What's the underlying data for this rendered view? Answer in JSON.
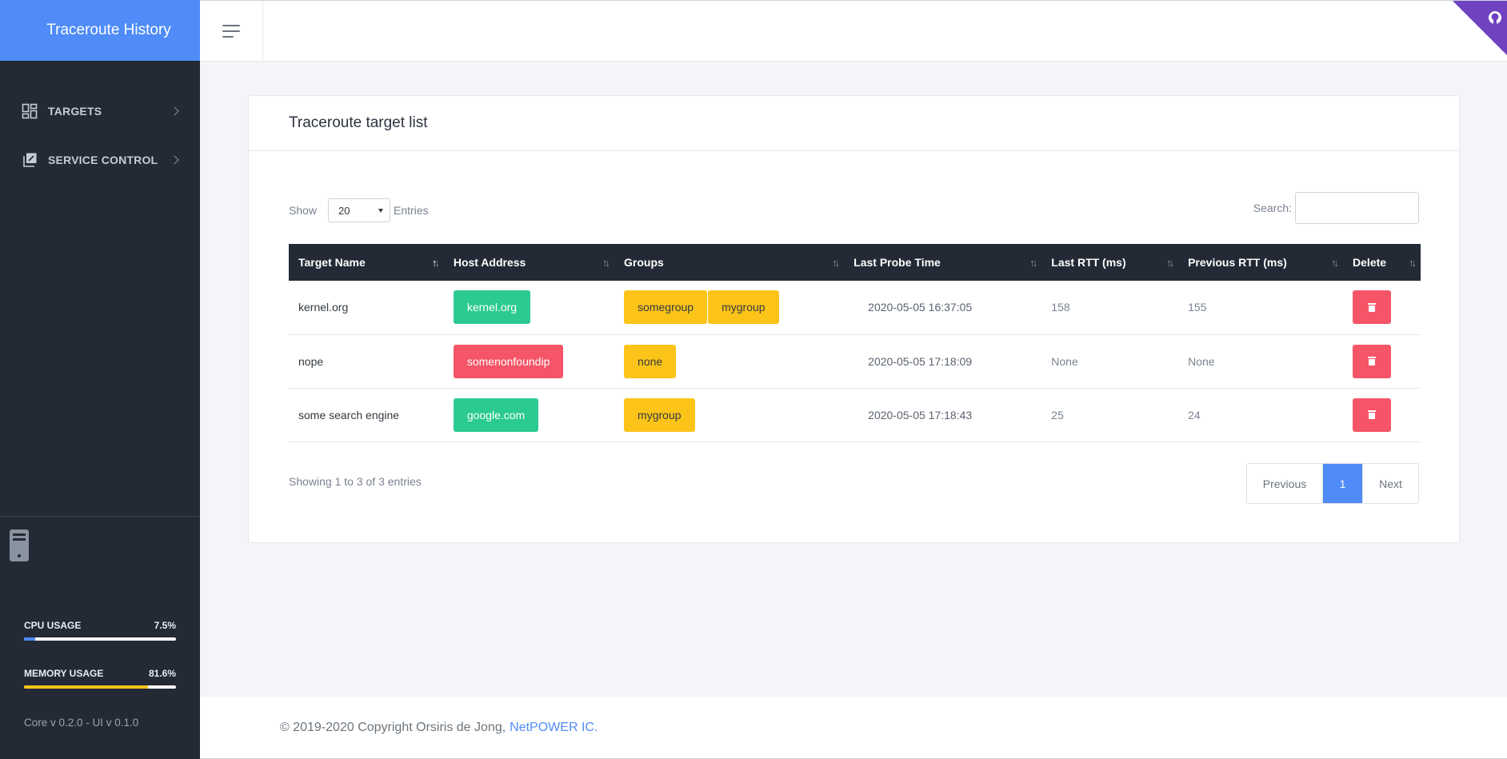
{
  "app": {
    "title": "Traceroute History"
  },
  "sidebar": {
    "items": [
      {
        "label": "TARGETS",
        "icon": "dashboard-grid-icon"
      },
      {
        "label": "SERVICE CONTROL",
        "icon": "edit-box-icon"
      }
    ],
    "cpu": {
      "label": "CPU USAGE",
      "value": "7.5%",
      "percent": 7.5,
      "color": "#4f8cf7"
    },
    "memory": {
      "label": "MEMORY USAGE",
      "value": "81.6%",
      "percent": 81.6,
      "color": "#fcc419"
    },
    "version": "Core v 0.2.0 - UI v 0.1.0"
  },
  "card": {
    "title": "Traceroute target list",
    "show_label": "Show",
    "entries_value": "20",
    "entries_label": "Entries",
    "search_label": "Search:",
    "search_value": "",
    "columns": [
      "Target Name",
      "Host Address",
      "Groups",
      "Last Probe Time",
      "Last RTT (ms)",
      "Previous RTT (ms)",
      "Delete"
    ],
    "rows": [
      {
        "name": "kernel.org",
        "host": "kernel.org",
        "host_status": "ok",
        "groups": [
          "somegroup",
          "mygroup"
        ],
        "last_probe": "2020-05-05 16:37:05",
        "last_rtt": "158",
        "prev_rtt": "155"
      },
      {
        "name": "nope",
        "host": "somenonfoundip",
        "host_status": "error",
        "groups": [
          "none"
        ],
        "last_probe": "2020-05-05 17:18:09",
        "last_rtt": "None",
        "prev_rtt": "None"
      },
      {
        "name": "some search engine",
        "host": "google.com",
        "host_status": "ok",
        "groups": [
          "mygroup"
        ],
        "last_probe": "2020-05-05 17:18:43",
        "last_rtt": "25",
        "prev_rtt": "24"
      }
    ],
    "info": "Showing 1 to 3 of 3 entries",
    "pagination": {
      "previous": "Previous",
      "current": "1",
      "next": "Next"
    }
  },
  "footer": {
    "copyright": "© 2019-2020 Copyright Orsiris de Jong,",
    "link": "NetPOWER IC."
  },
  "colors": {
    "brand": "#4f8cf7",
    "sidebar": "#232a35",
    "success": "#2bca90",
    "danger": "#f55567",
    "warning": "#fcc419",
    "github_corner": "#6f42c1"
  }
}
